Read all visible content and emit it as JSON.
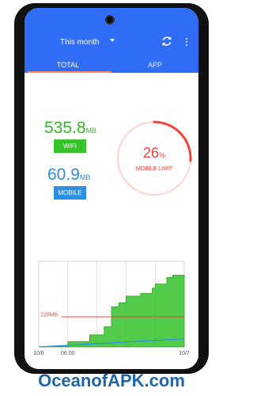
{
  "header": {
    "period_label": "This month",
    "tabs": [
      "TOTAL",
      "APP"
    ]
  },
  "usage": {
    "wifi_value": "535.8",
    "wifi_unit": "MB",
    "wifi_label": "WIFI",
    "mobile_value": "60.9",
    "mobile_unit": "MB",
    "mobile_label": "MOBILE"
  },
  "limit": {
    "percent_value": "26",
    "percent_sign": "%",
    "percent": 26,
    "label": "MOBILE LIMIT"
  },
  "chart_data": {
    "type": "area",
    "x_tick_labels": [
      "10/6",
      "06:00",
      "",
      "",
      "",
      "10/7"
    ],
    "limit_label": "225MB",
    "limit_value": 225,
    "ylim": [
      0,
      640
    ],
    "wifi": {
      "x": [
        0,
        0.1,
        0.2,
        0.35,
        0.45,
        0.5,
        0.55,
        0.6,
        0.62,
        0.7,
        0.78,
        0.8,
        0.88,
        0.92,
        1.0
      ],
      "values": [
        0,
        5,
        40,
        90,
        150,
        300,
        330,
        380,
        380,
        400,
        440,
        470,
        520,
        535.8,
        535.8
      ]
    },
    "mobile": {
      "x": [
        0,
        1.0
      ],
      "values": [
        0,
        60.9
      ]
    }
  },
  "colors": {
    "appbar": "#2f6df6",
    "wifi": "#35c22a",
    "mobile": "#2b8fe3",
    "limit": "#f44336"
  },
  "branding": {
    "text": "OceanofAPK.com"
  }
}
